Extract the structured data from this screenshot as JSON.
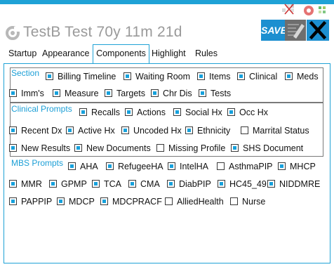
{
  "window": {
    "title": "TestB Test 70y 11m 21d",
    "accent": "#1fa2d6"
  },
  "toolbar": {
    "save_label": "SAVE",
    "edit_icon": "pencil-icon",
    "close_icon": "close-x-icon"
  },
  "tabs": [
    "Startup",
    "Appearance",
    "Components",
    "Highlight",
    "Rules"
  ],
  "active_tab": "Components",
  "section": {
    "label": "Section",
    "items": [
      {
        "label": "Billing Timeline",
        "checked": true
      },
      {
        "label": "Waiting Room",
        "checked": true
      },
      {
        "label": "Items",
        "checked": true
      },
      {
        "label": "Clinical",
        "checked": true
      },
      {
        "label": "Meds",
        "checked": true
      },
      {
        "label": "Imm's",
        "checked": true
      },
      {
        "label": "Measure",
        "checked": true
      },
      {
        "label": "Targets",
        "checked": true
      },
      {
        "label": "Chr Dis",
        "checked": true
      },
      {
        "label": "Tests",
        "checked": true
      }
    ]
  },
  "clinical_prompts": {
    "label": "Clinical Prompts",
    "items": [
      {
        "label": "Recalls",
        "checked": true
      },
      {
        "label": "Actions",
        "checked": true
      },
      {
        "label": "Social Hx",
        "checked": true
      },
      {
        "label": "Occ Hx",
        "checked": true
      },
      {
        "label": "Recent Dx",
        "checked": true
      },
      {
        "label": "Active Hx",
        "checked": true
      },
      {
        "label": "Uncoded Hx",
        "checked": true
      },
      {
        "label": "Ethnicity",
        "checked": true
      },
      {
        "label": "Marrital Status",
        "checked": false
      },
      {
        "label": "New Results",
        "checked": true
      },
      {
        "label": "New Documents",
        "checked": true
      },
      {
        "label": "Missing Profile",
        "checked": false
      },
      {
        "label": "SHS Document",
        "checked": true
      }
    ]
  },
  "mbs_prompts": {
    "label": "MBS Prompts",
    "items": [
      {
        "label": "AHA",
        "checked": true
      },
      {
        "label": "RefugeeHA",
        "checked": true
      },
      {
        "label": "IntelHA",
        "checked": true
      },
      {
        "label": "AsthmaPIP",
        "checked": false
      },
      {
        "label": "MHCP",
        "checked": true
      },
      {
        "label": "MMR",
        "checked": true
      },
      {
        "label": "GPMP",
        "checked": true
      },
      {
        "label": "TCA",
        "checked": true
      },
      {
        "label": "CMA",
        "checked": true
      },
      {
        "label": "DiabPIP",
        "checked": true
      },
      {
        "label": "HC45_49",
        "checked": true
      },
      {
        "label": "NIDDMRE",
        "checked": true
      },
      {
        "label": "PAPPIP",
        "checked": true
      },
      {
        "label": "MDCP",
        "checked": true
      },
      {
        "label": "MDCPRACF",
        "checked": true
      },
      {
        "label": "AlliedHealth",
        "checked": false
      },
      {
        "label": "Nurse",
        "checked": false
      }
    ]
  }
}
